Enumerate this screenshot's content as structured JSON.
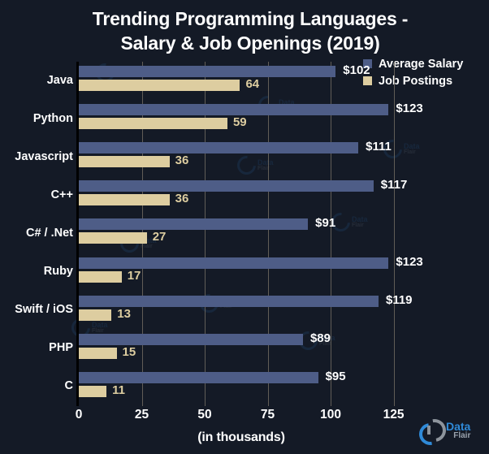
{
  "chart_data": {
    "type": "bar",
    "orientation": "horizontal",
    "title": "Trending Programming Languages -\nSalary & Job Openings (2019)",
    "xlabel": "(in thousands)",
    "ylabel": "",
    "xlim": [
      0,
      129
    ],
    "xticks": [
      "0",
      "25",
      "50",
      "75",
      "100",
      "125"
    ],
    "xtick_values": [
      0,
      25,
      50,
      75,
      100,
      125
    ],
    "grid": "vertical",
    "legend_position": "top-right",
    "categories": [
      "Java",
      "Python",
      "Javascript",
      "C++",
      "C# / .Net",
      "Ruby",
      "Swift / iOS",
      "PHP",
      "C"
    ],
    "series": [
      {
        "name": "Average Salary",
        "color": "#4e5d87",
        "values": [
          102,
          123,
          111,
          117,
          91,
          123,
          119,
          89,
          95
        ],
        "labels": [
          "$102",
          "$123",
          "$111",
          "$117",
          "$91",
          "$123",
          "$119",
          "$89",
          "$95"
        ]
      },
      {
        "name": "Job Postings",
        "color": "#ddcda0",
        "values": [
          64,
          59,
          36,
          36,
          27,
          17,
          13,
          15,
          11
        ],
        "labels": [
          "64",
          "59",
          "36",
          "36",
          "27",
          "17",
          "13",
          "15",
          "11"
        ]
      }
    ]
  },
  "legend": {
    "items": [
      {
        "label": "Average Salary",
        "color": "#4e5d87"
      },
      {
        "label": "Job Postings",
        "color": "#ddcda0"
      }
    ]
  },
  "brand": {
    "data_text": "Data",
    "flair_text": "Flair"
  },
  "colors": {
    "background": "#141a26",
    "salary_bar": "#4e5d87",
    "postings_bar": "#ddcda0",
    "text": "#ffffff",
    "gridline": "#6f6a60",
    "axis": "#000000",
    "brand_blue": "#2f8ad8",
    "brand_gray": "#9aa3ae"
  }
}
